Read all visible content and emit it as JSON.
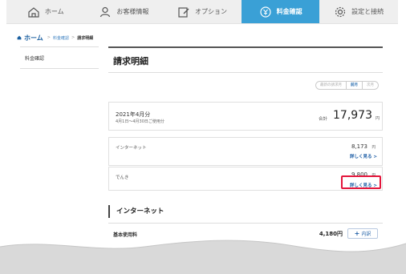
{
  "nav": {
    "items": [
      {
        "label": "ホーム",
        "icon": "home-icon"
      },
      {
        "label": "お客様情報",
        "icon": "user-icon"
      },
      {
        "label": "オプション",
        "icon": "edit-icon"
      },
      {
        "label": "料金確認",
        "icon": "coin-icon",
        "active": true
      },
      {
        "label": "設定と接続",
        "icon": "gear-icon"
      }
    ]
  },
  "breadcrumb": {
    "home": "ホーム",
    "sep": ">",
    "level1": "料金確認",
    "current": "請求明細"
  },
  "sidebar": {
    "item": "料金確認"
  },
  "main": {
    "title": "請求明細",
    "month_nav": {
      "latest": "最新の請求月",
      "prev": "前月",
      "next": "次月"
    },
    "summary": {
      "month": "2021年4月分",
      "period": "4月1日〜4月30日ご使用分",
      "total_label": "合計",
      "total": "17,973",
      "yen": "円"
    },
    "internet_card": {
      "label": "インターネット",
      "amount": "8,173",
      "yen": "円",
      "link": "詳しく見る >"
    },
    "denki_card": {
      "label": "でんき",
      "amount": "9,800",
      "yen": "円",
      "link": "詳しく見る >"
    },
    "section": {
      "heading": "インターネット",
      "row_label": "基本使用料",
      "row_amount": "4,180円",
      "breakdown_plus": "+",
      "breakdown": "内訳"
    }
  },
  "colors": {
    "accent": "#3aa0d6",
    "link": "#1f5fa6",
    "highlight": "#e3153b"
  }
}
